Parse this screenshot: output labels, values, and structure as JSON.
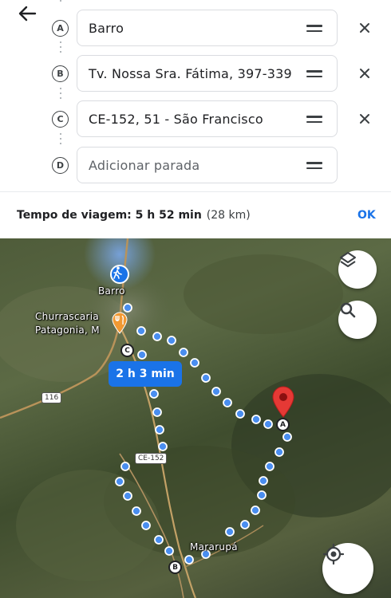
{
  "stops": [
    {
      "letter": "A",
      "value": "Barro"
    },
    {
      "letter": "B",
      "value": "Tv. Nossa Sra. Fátima, 397-339"
    },
    {
      "letter": "C",
      "value": "CE-152, 51 - São Francisco"
    },
    {
      "letter": "D",
      "placeholder": "Adicionar parada"
    }
  ],
  "summary": {
    "label": "Tempo de viagem: 5 h 52 min",
    "distance": "(28 km)",
    "ok": "OK"
  },
  "map": {
    "labels": {
      "barro": "Barro",
      "churrascaria": "Churrascaria\nPatagonia, M",
      "mararupa": "Mararupá"
    },
    "route_time": "2 h 3 min",
    "road_116": "116",
    "road_ce152": "CE-152",
    "markers": {
      "a": "A",
      "b": "B",
      "c": "C"
    }
  },
  "icons": {
    "back": "arrow-back-icon",
    "layers": "layers-icon",
    "search": "search-icon",
    "my_location": "my-location-icon",
    "walking": "walking-person-icon",
    "restaurant": "restaurant-icon",
    "pin": "destination-pin-icon"
  },
  "colors": {
    "accent": "#1a73e8",
    "route_dot": "#4a8ef0",
    "pin": "#e53935"
  }
}
